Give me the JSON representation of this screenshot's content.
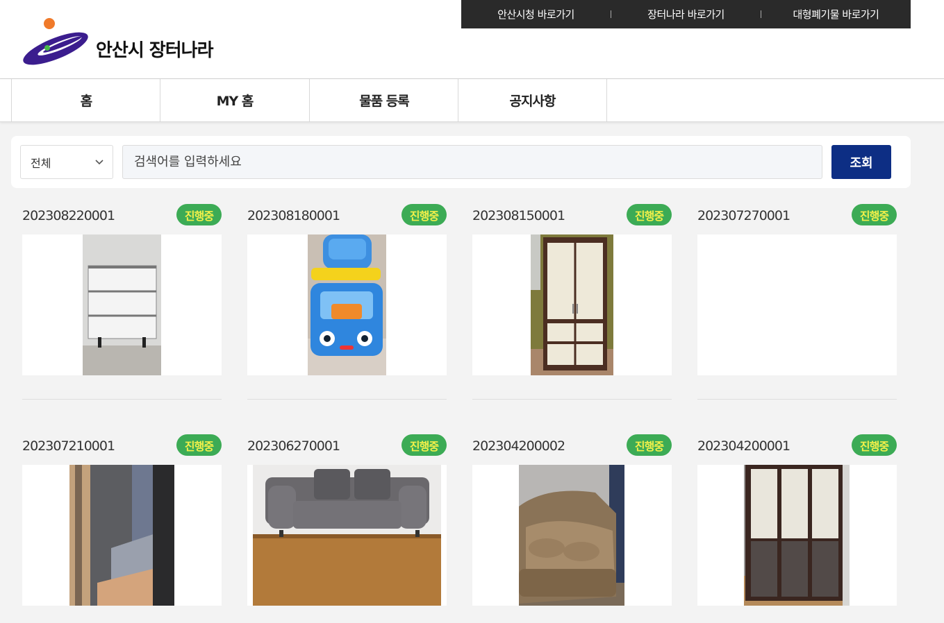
{
  "header": {
    "brand": "안산시 장터나라",
    "top_links": [
      "안산시청 바로가기",
      "장터나라 바로가기",
      "대형폐기물 바로가기"
    ]
  },
  "nav": [
    "홈",
    "MY 홈",
    "물품 등록",
    "공지사항"
  ],
  "search": {
    "category": "전체",
    "placeholder": "검색어를 입력하세요",
    "button": "조회"
  },
  "items": [
    {
      "id": "202308220001",
      "status": "진행중",
      "image": "white-drawer-cabinet"
    },
    {
      "id": "202308180001",
      "status": "진행중",
      "image": "kids-ride-on-car"
    },
    {
      "id": "202308150001",
      "status": "진행중",
      "image": "wardrobe"
    },
    {
      "id": "202307270001",
      "status": "진행중",
      "image": "no-image"
    },
    {
      "id": "202307210001",
      "status": "진행중",
      "image": "rolled-rug"
    },
    {
      "id": "202306270001",
      "status": "진행중",
      "image": "gray-fabric-sofa"
    },
    {
      "id": "202304200002",
      "status": "진행중",
      "image": "leather-sofa"
    },
    {
      "id": "202304200001",
      "status": "진행중",
      "image": "glass-door-cabinet"
    }
  ],
  "colors": {
    "badge_bg": "#3cab55",
    "badge_text": "#f3f04a",
    "search_button": "#0d2e84",
    "top_bar": "#2a2a2a"
  }
}
